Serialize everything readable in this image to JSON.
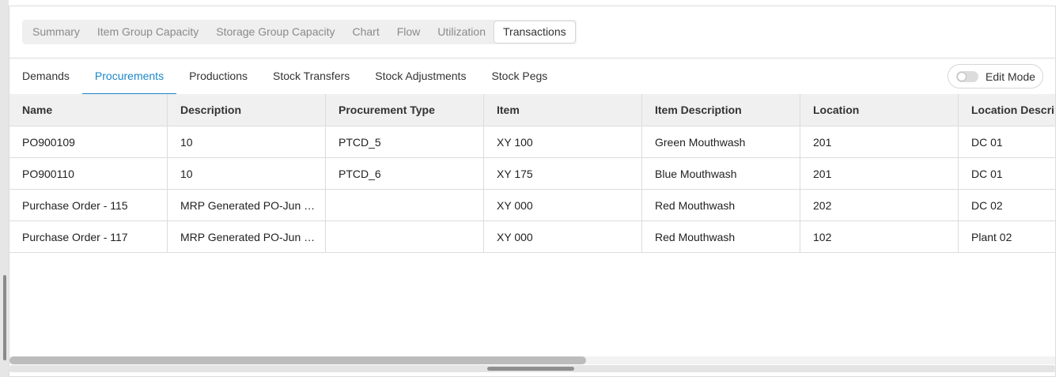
{
  "top_tabs": [
    {
      "label": "Summary"
    },
    {
      "label": "Item Group Capacity"
    },
    {
      "label": "Storage Group Capacity"
    },
    {
      "label": "Chart"
    },
    {
      "label": "Flow"
    },
    {
      "label": "Utilization"
    },
    {
      "label": "Transactions",
      "active": true
    }
  ],
  "sub_tabs": [
    {
      "label": "Demands"
    },
    {
      "label": "Procurements",
      "active": true
    },
    {
      "label": "Productions"
    },
    {
      "label": "Stock Transfers"
    },
    {
      "label": "Stock Adjustments"
    },
    {
      "label": "Stock Pegs"
    }
  ],
  "edit_mode": {
    "label": "Edit Mode",
    "enabled": false
  },
  "table": {
    "columns": [
      "Name",
      "Description",
      "Procurement Type",
      "Item",
      "Item Description",
      "Location",
      "Location Descript"
    ],
    "rows": [
      [
        "PO900109",
        "10",
        "PTCD_5",
        "XY 100",
        "Green Mouthwash",
        "201",
        "DC 01"
      ],
      [
        "PO900110",
        "10",
        "PTCD_6",
        "XY 175",
        "Blue Mouthwash",
        "201",
        "DC 01"
      ],
      [
        "Purchase Order - 115",
        "MRP Generated PO-Jun 0…",
        "",
        "XY 000",
        "Red Mouthwash",
        "202",
        "DC 02"
      ],
      [
        "Purchase Order - 117",
        "MRP Generated PO-Jun 0…",
        "",
        "XY 000",
        "Red Mouthwash",
        "102",
        "Plant 02"
      ]
    ]
  },
  "colors": {
    "accent": "#1b87c9",
    "header_bg": "#f0f0f0",
    "border": "#dcdcdc"
  }
}
